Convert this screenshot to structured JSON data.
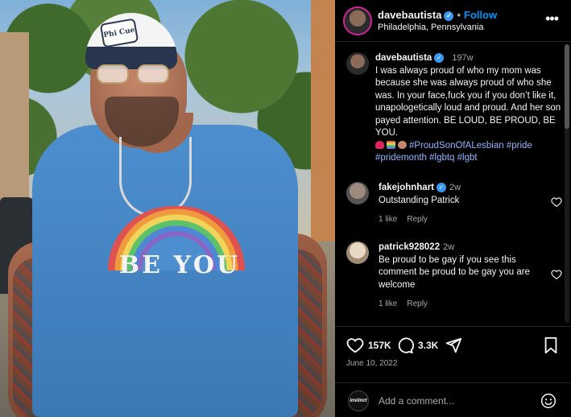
{
  "post": {
    "username": "davebautista",
    "follow_label": "Follow",
    "location": "Philadelphia, Pennsylvania",
    "more_label": "•••",
    "photo": {
      "cap_text": "Phi Cue",
      "shirt_text": "BE YOU"
    },
    "caption": {
      "username": "davebautista",
      "time": "197w",
      "text": "I was always proud of who my mom was because she was always proud of who she was. In your face,fuck you if you don’t like it, unapologetically loud and proud. And her son payed attention. BE LOUD, BE PROUD, BE YOU.",
      "tags": "#ProudSonOfALesbian #pride #pridemonth #lgbtq #lgbt"
    },
    "comments": [
      {
        "username": "fakejohnhart",
        "time": "2w",
        "text": "Outstanding Patrick",
        "likes": "1 like",
        "reply_label": "Reply"
      },
      {
        "username": "patrick928022",
        "time": "2w",
        "text": "Be proud to be gay if you see this comment be proud to be gay you are welcome",
        "likes": "1 like",
        "reply_label": "Reply"
      }
    ],
    "actions": {
      "likes": "157K",
      "comments": "3.3K"
    },
    "date": "June 10, 2022",
    "add_comment": {
      "avatar_text": "instinct",
      "placeholder": "Add a comment..."
    }
  },
  "colors": {
    "accent": "#0095f6",
    "verified": "#3897f0",
    "hashtag": "#8fb5ff",
    "muted": "#a8a8a8"
  },
  "icons": [
    "verified-icon",
    "more-icon",
    "heart-icon",
    "comment-icon",
    "share-icon",
    "bookmark-icon",
    "emoji-icon"
  ]
}
